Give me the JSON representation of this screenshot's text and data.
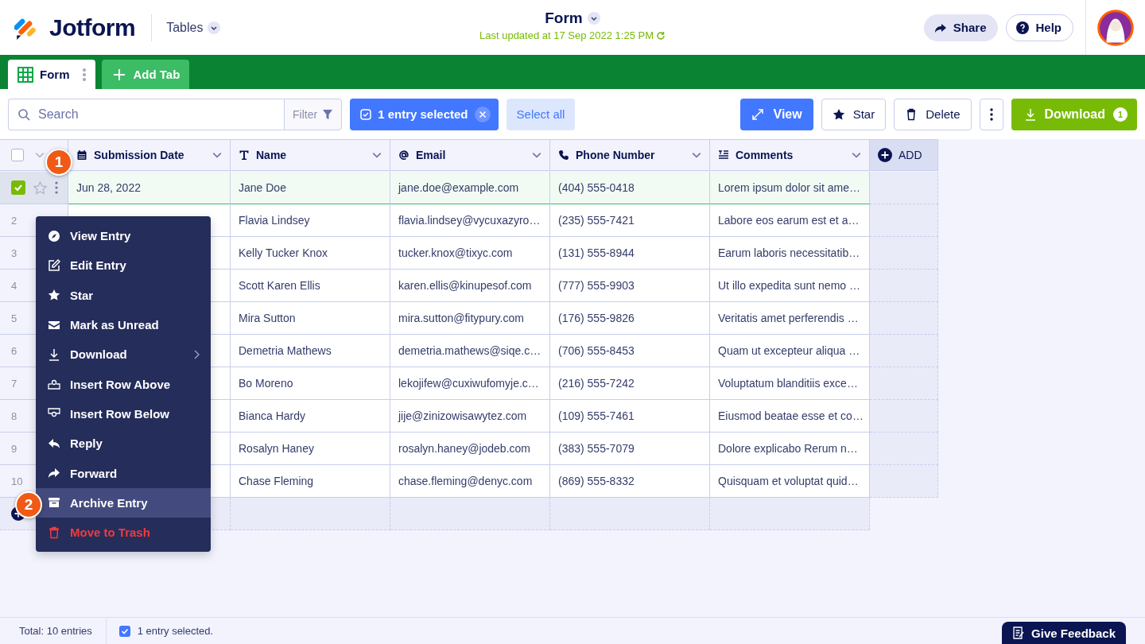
{
  "header": {
    "brand": "Jotform",
    "section": "Tables",
    "title": "Form",
    "last_updated": "Last updated at 17 Sep 2022 1:25 PM",
    "buttons": [
      "Share",
      "Help"
    ]
  },
  "tabs": [
    {
      "label": "Form",
      "selected": true
    },
    {
      "label": "Add Tab",
      "selected": false
    }
  ],
  "toolbar": {
    "search": {
      "placeholder": "Search"
    },
    "filter": "Filter",
    "selection": "1 entry selected",
    "select_all": "Select all",
    "view": "View",
    "star": "Star",
    "delete": "Delete",
    "download": "Download",
    "download_count": "1"
  },
  "table": {
    "select_all_checked": false,
    "columns": [
      "Submission Date",
      "Name",
      "Email",
      "Phone Number",
      "Comments"
    ],
    "add_column": "ADD",
    "rows": [
      {
        "selected": true,
        "cells": [
          "Jun 28, 2022",
          "Jane Doe",
          "jane.doe@example.com",
          "(404) 555-0418",
          "Lorem ipsum dolor sit ame…"
        ]
      },
      {
        "number": "2",
        "selected": false,
        "cells": [
          "",
          "Flavia Lindsey",
          "flavia.lindsey@vycuxazyro…",
          "(235) 555-7421",
          "Labore eos earum est et a…"
        ]
      },
      {
        "number": "3",
        "selected": false,
        "cells": [
          "",
          "Kelly Tucker Knox",
          "tucker.knox@tixyc.com",
          "(131) 555-8944",
          "Earum laboris necessitatib…"
        ]
      },
      {
        "number": "4",
        "selected": false,
        "cells": [
          "",
          "Scott Karen Ellis",
          "karen.ellis@kinupesof.com",
          "(777) 555-9903",
          "Ut illo expedita sunt nemo …"
        ]
      },
      {
        "number": "5",
        "selected": false,
        "cells": [
          "",
          "Mira Sutton",
          "mira.sutton@fitypury.com",
          "(176) 555-9826",
          "Veritatis amet perferendis …"
        ]
      },
      {
        "number": "6",
        "selected": false,
        "cells": [
          "",
          "Demetria Mathews",
          "demetria.mathews@siqe.c…",
          "(706) 555-8453",
          "Quam ut excepteur aliqua …"
        ]
      },
      {
        "number": "7",
        "selected": false,
        "cells": [
          "",
          "Bo Moreno",
          "lekojifew@cuxiwufomyje.c…",
          "(216) 555-7242",
          "Voluptatum blanditiis exce…"
        ]
      },
      {
        "number": "8",
        "selected": false,
        "cells": [
          "",
          "Bianca Hardy",
          "jije@zinizowisawytez.com",
          "(109) 555-7461",
          "Eiusmod beatae esse et co…"
        ]
      },
      {
        "number": "9",
        "selected": false,
        "cells": [
          "",
          "Rosalyn Haney",
          "rosalyn.haney@jodeb.com",
          "(383) 555-7079",
          "Dolore explicabo Rerum n…"
        ]
      },
      {
        "number": "10",
        "selected": false,
        "cells": [
          "",
          "Chase Fleming",
          "chase.fleming@denyc.com",
          "(869) 555-8332",
          "Quisquam et voluptat quid…"
        ]
      }
    ]
  },
  "context_menu": [
    {
      "label": "View Entry",
      "selected": false,
      "destructive": false
    },
    {
      "label": "Edit Entry",
      "selected": false,
      "destructive": false
    },
    {
      "label": "Star",
      "selected": false,
      "destructive": false
    },
    {
      "label": "Mark as Unread",
      "selected": false,
      "destructive": false
    },
    {
      "label": "Download",
      "selected": false,
      "destructive": false,
      "submenu": true
    },
    {
      "label": "Insert Row Above",
      "selected": false,
      "destructive": false
    },
    {
      "label": "Insert Row Below",
      "selected": false,
      "destructive": false
    },
    {
      "label": "Reply",
      "selected": false,
      "destructive": false
    },
    {
      "label": "Forward",
      "selected": false,
      "destructive": false
    },
    {
      "label": "Archive Entry",
      "selected": true,
      "destructive": false
    },
    {
      "label": "Move to Trash",
      "selected": false,
      "destructive": true
    }
  ],
  "callouts": [
    {
      "label": "1"
    },
    {
      "label": "2"
    }
  ],
  "status_bar": {
    "total": "Total: 10 entries",
    "selected": "1 entry selected.",
    "feedback": "Give Feedback"
  }
}
